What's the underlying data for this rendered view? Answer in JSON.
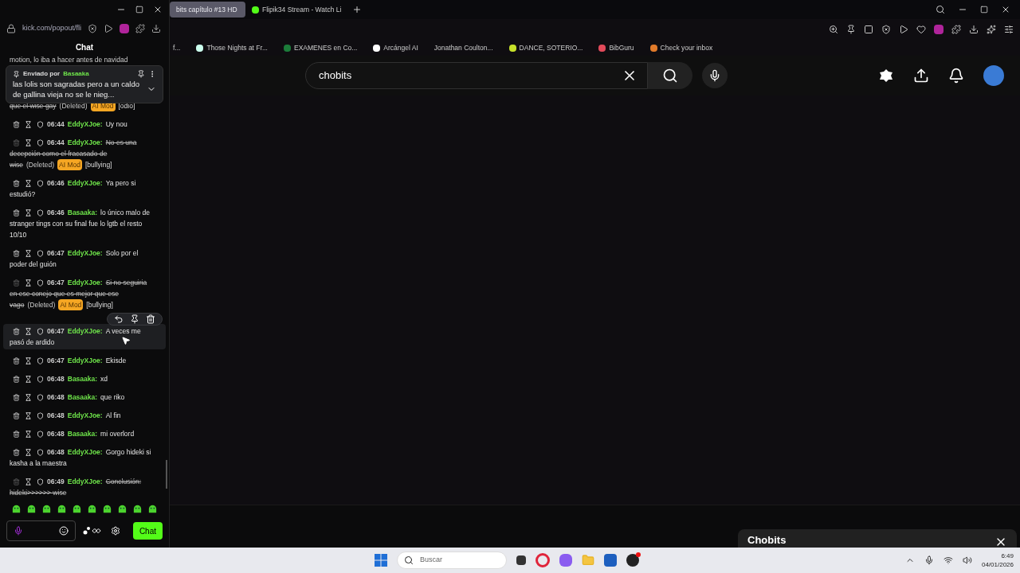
{
  "chat_window": {
    "url": "kick.com/popout/fli",
    "title": "Chat",
    "pinned": {
      "label": "Enviado por",
      "user": "Basaaka",
      "text": "las lolis son sagradas pero a un caldo de gallina vieja no se le nieg..."
    },
    "top_fragment": "motion, lo iba a hacer antes de navidad",
    "messages": [
      {
        "kind": "continuation",
        "lines": [
          "que el wise gay"
        ],
        "deleted": true,
        "deleted_label": "(Deleted)",
        "mod_tag": "AI Mod",
        "reason": "[odio]",
        "hovered": false
      },
      {
        "kind": "message",
        "time": "06:44",
        "user": "EddyXJoe:",
        "text": "Uy nou",
        "deleted": false,
        "hovered": false
      },
      {
        "kind": "message",
        "time": "06:44",
        "user": "EddyXJoe:",
        "text": "No es una",
        "lines": [
          "decepción como el fracasado de",
          "wise"
        ],
        "deleted": true,
        "deleted_label": "(Deleted)",
        "mod_tag": "AI Mod",
        "reason": "[bullying]",
        "hovered": false
      },
      {
        "kind": "message",
        "time": "06:46",
        "user": "EddyXJoe:",
        "text": "Ya pero si",
        "lines": [
          "estudió?"
        ],
        "deleted": false,
        "hovered": false
      },
      {
        "kind": "message",
        "time": "06:46",
        "user": "Basaaka:",
        "text": "lo único malo de",
        "lines": [
          "stranger tings con su final fue lo lgtb el resto",
          "10/10"
        ],
        "deleted": false,
        "hovered": false
      },
      {
        "kind": "message",
        "time": "06:47",
        "user": "EddyXJoe:",
        "text": "Solo por el",
        "lines": [
          "poder del guión"
        ],
        "deleted": false,
        "hovered": false
      },
      {
        "kind": "message",
        "time": "06:47",
        "user": "EddyXJoe:",
        "text": "Si no seguiria",
        "lines": [
          "en ese conejo que es mejor que ese",
          "vago"
        ],
        "deleted": true,
        "deleted_label": "(Deleted)",
        "mod_tag": "AI Mod",
        "reason": "[bullying]",
        "hovered": false
      },
      {
        "kind": "message",
        "time": "06:47",
        "user": "EddyXJoe:",
        "text": "A veces me",
        "lines": [
          "pasó de ardido"
        ],
        "deleted": false,
        "hovered": true
      },
      {
        "kind": "message",
        "time": "06:47",
        "user": "EddyXJoe:",
        "text": "Ekisde",
        "deleted": false,
        "hovered": false
      },
      {
        "kind": "message",
        "time": "06:48",
        "user": "Basaaka:",
        "text": "xd",
        "deleted": false,
        "hovered": false
      },
      {
        "kind": "message",
        "time": "06:48",
        "user": "Basaaka:",
        "text": "que riko",
        "deleted": false,
        "hovered": false
      },
      {
        "kind": "message",
        "time": "06:48",
        "user": "EddyXJoe:",
        "text": "Al fin",
        "deleted": false,
        "hovered": false
      },
      {
        "kind": "message",
        "time": "06:48",
        "user": "Basaaka:",
        "text": "mi overlord",
        "deleted": false,
        "hovered": false
      },
      {
        "kind": "message",
        "time": "06:48",
        "user": "EddyXJoe:",
        "text": "Gorgo hideki si",
        "lines": [
          "kasha a la maestra"
        ],
        "deleted": false,
        "hovered": false
      },
      {
        "kind": "message",
        "time": "06:49",
        "user": "EddyXJoe:",
        "text": "Conclusión:",
        "lines": [
          "hideki>>>>>> wise"
        ],
        "deleted": true,
        "hovered": false
      }
    ],
    "send_button": "Chat"
  },
  "browser": {
    "tabs": [
      {
        "title": "bits capítulo #13 HD",
        "selected": true
      },
      {
        "title": "Flipik34 Stream - Watch Li",
        "selected": false
      }
    ],
    "bookmarks": [
      "f...",
      "Those Nights at Fr...",
      "EXAMENES en Co...",
      "Arcángel AI",
      "Jonathan Coulton...",
      "DANCE, SOTERIO...",
      "BibGuru",
      "Check your inbox"
    ],
    "search": {
      "value": "chobits"
    },
    "mini_player": {
      "title": "Chobits"
    }
  },
  "taskbar": {
    "search_placeholder": "Buscar",
    "time": "6:49",
    "date": "04/01/2026"
  }
}
